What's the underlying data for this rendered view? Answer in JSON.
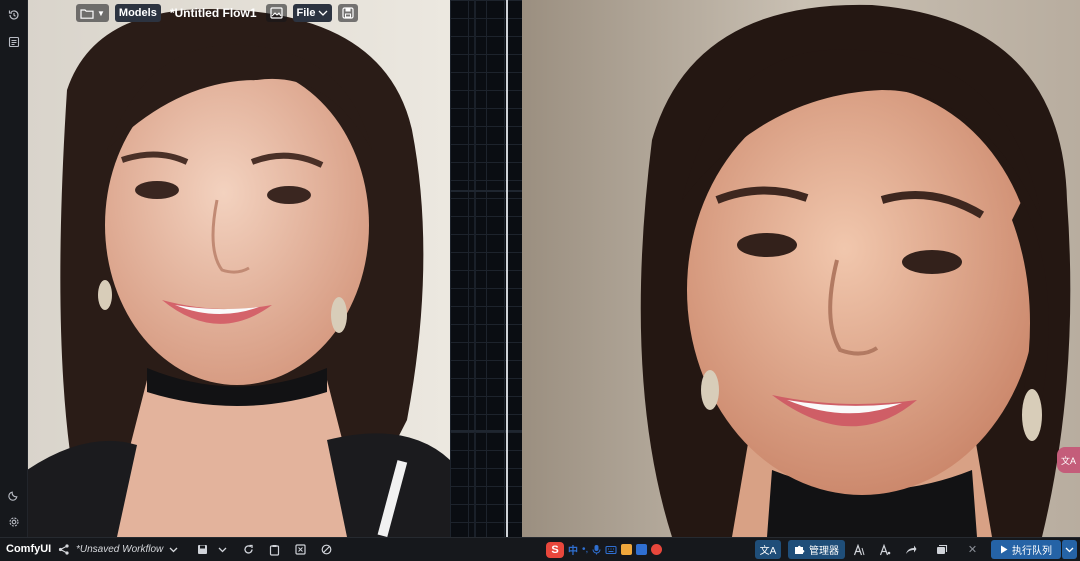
{
  "toolbar": {
    "folder_icon": "folder-icon",
    "models_label": "Models",
    "workflow_title": "*Untitled Flow1",
    "image_icon": "image-icon",
    "file_label": "File",
    "save_icon": "save-icon"
  },
  "left_rail": {
    "items": [
      "history-icon",
      "queue-list-icon"
    ],
    "bottom_items": [
      "theme-toggle-icon",
      "settings-gear-icon"
    ]
  },
  "bottom_bar": {
    "brand": "ComfyUI",
    "workflow_name": "*Unsaved Workflow",
    "ime_label": "中",
    "manager_label": "管理器",
    "queue_label": "执行队列",
    "translate_glyph": "文A",
    "close_glyph": "✕"
  },
  "side_tab": {
    "label": "文A"
  },
  "colors": {
    "canvas_bg": "#0b0e13",
    "bar_bg": "#16181c",
    "accent_blue": "#2563a6",
    "ime_red": "#e8473c"
  }
}
